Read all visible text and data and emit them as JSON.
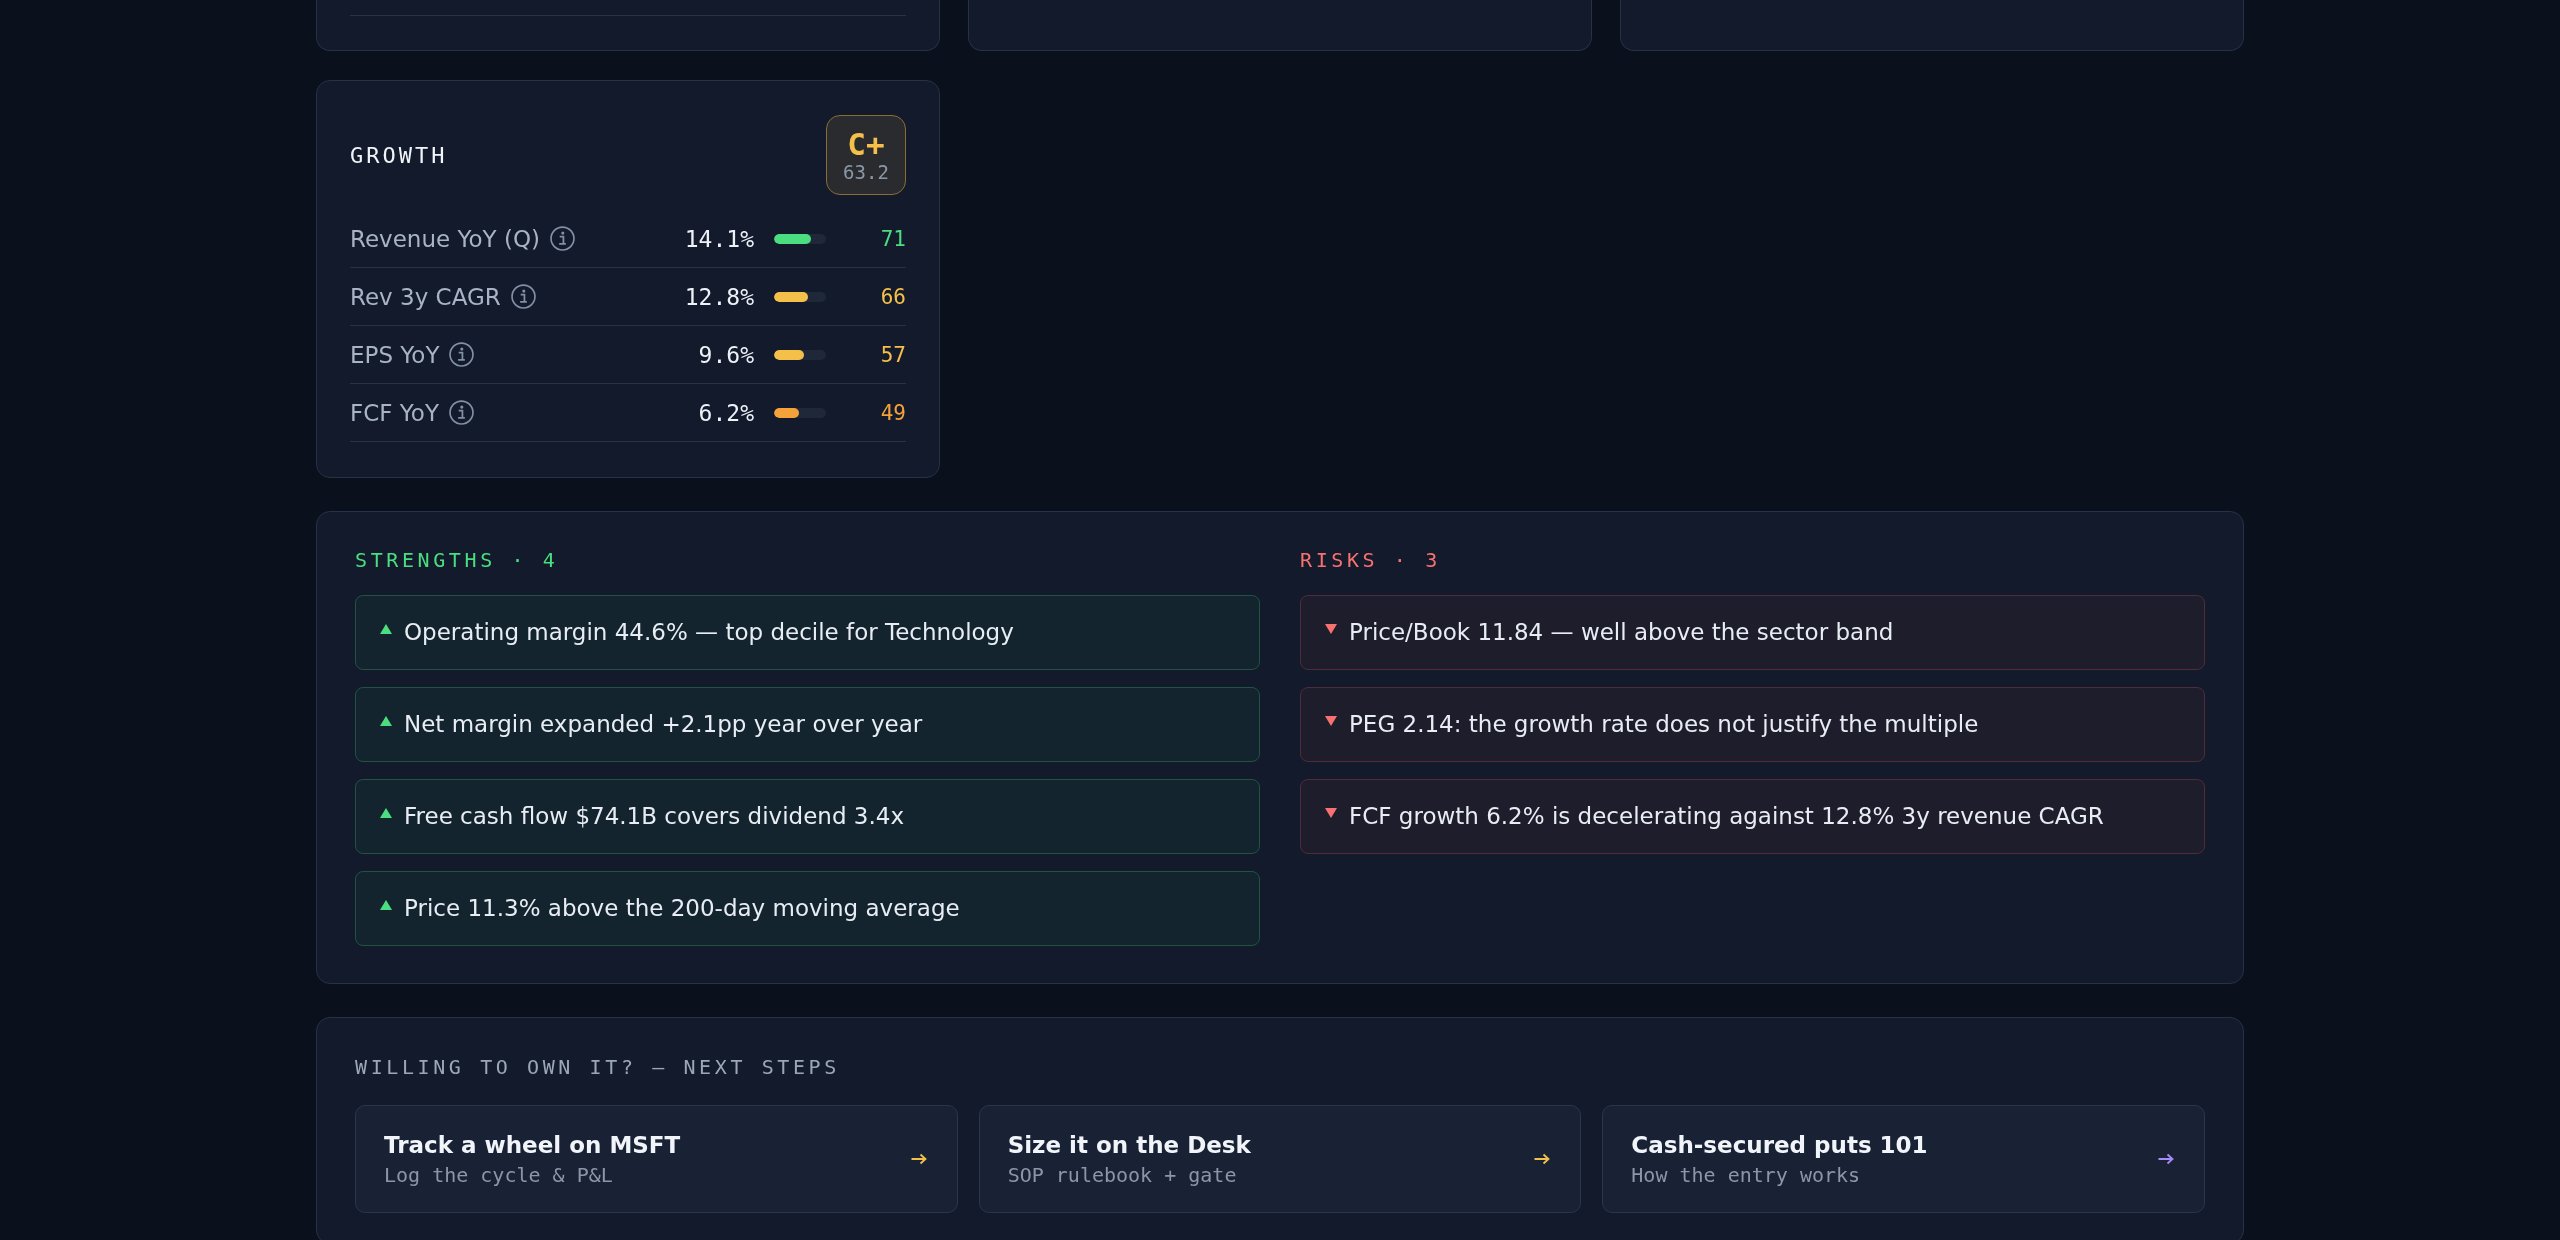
{
  "growth": {
    "title": "GROWTH",
    "grade": "C+",
    "score": "63.2",
    "metrics": [
      {
        "label": "Revenue YoY (Q)",
        "value": "14.1%",
        "level": 0.71,
        "score": "71",
        "color": "#4ade80"
      },
      {
        "label": "Rev 3y CAGR",
        "value": "12.8%",
        "level": 0.66,
        "score": "66",
        "color": "#f5c04a"
      },
      {
        "label": "EPS YoY",
        "value": "9.6%",
        "level": 0.57,
        "score": "57",
        "color": "#f5c04a"
      },
      {
        "label": "FCF YoY",
        "value": "6.2%",
        "level": 0.49,
        "score": "49",
        "color": "#f5a23b"
      }
    ]
  },
  "signals": [
    {
      "kind": "strength",
      "title": "STRENGTHS · 4",
      "items": [
        "Operating margin 44.6% — top decile for Technology",
        "Net margin expanded +2.1pp year over year",
        "Free cash flow $74.1B covers dividend 3.4x",
        "Price 11.3% above the 200-day moving average"
      ]
    },
    {
      "kind": "risk",
      "title": "RISKS · 3",
      "items": [
        "Price/Book 11.84 — well above the sector band",
        "PEG 2.14: the growth rate does not justify the multiple",
        "FCF growth 6.2% is decelerating against 12.8% 3y revenue CAGR"
      ]
    }
  ],
  "next_steps": {
    "title": "WILLING TO OWN IT? — NEXT STEPS",
    "links": [
      {
        "title": "Track a wheel on MSFT",
        "subtitle": "Log the cycle & P&L",
        "color": "#f5c04a"
      },
      {
        "title": "Size it on the Desk",
        "subtitle": "SOP rulebook + gate",
        "color": "#f5c04a"
      },
      {
        "title": "Cash-secured puts 101",
        "subtitle": "How the entry works",
        "color": "#a78bfa"
      }
    ]
  }
}
